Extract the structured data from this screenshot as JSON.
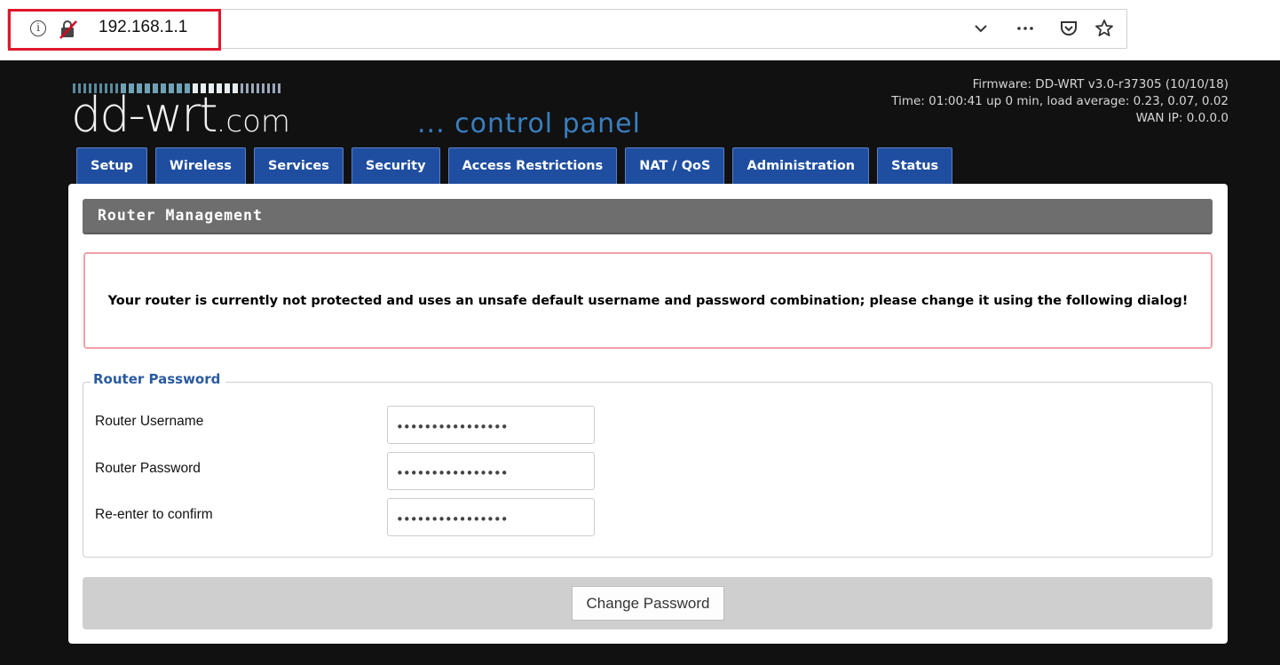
{
  "browser": {
    "url": "192.168.1.1",
    "icons": [
      "info-icon",
      "insecure-lock-icon",
      "chevron-down-icon",
      "more-icon",
      "pocket-icon",
      "bookmark-star-icon"
    ]
  },
  "header": {
    "logo": "dd-wrt.com",
    "subtitle": "... control panel",
    "firmware": "Firmware: DD-WRT v3.0-r37305 (10/10/18)",
    "time": "Time: 01:00:41 up 0 min, load average: 0.23, 0.07, 0.02",
    "wan_ip": "WAN IP: 0.0.0.0"
  },
  "tabs": [
    "Setup",
    "Wireless",
    "Services",
    "Security",
    "Access Restrictions",
    "NAT / QoS",
    "Administration",
    "Status"
  ],
  "main": {
    "section_title": "Router Management",
    "warning": "Your router is currently not protected and uses an unsafe default username and password combination; please change it using the following dialog!",
    "fieldset_legend": "Router Password",
    "fields": [
      {
        "label": "Router Username",
        "value": "••••••••••••••••"
      },
      {
        "label": "Router Password",
        "value": "••••••••••••••••"
      },
      {
        "label": "Re-enter to confirm",
        "value": "••••••••••••••••"
      }
    ],
    "change_button": "Change Password"
  },
  "colors": {
    "tab_bg": "#1f4ea1",
    "section_header": "#6e6e6e",
    "warning_border": "#f0a0a6",
    "legend": "#2a5aa0",
    "highlight": "#e0162b"
  }
}
